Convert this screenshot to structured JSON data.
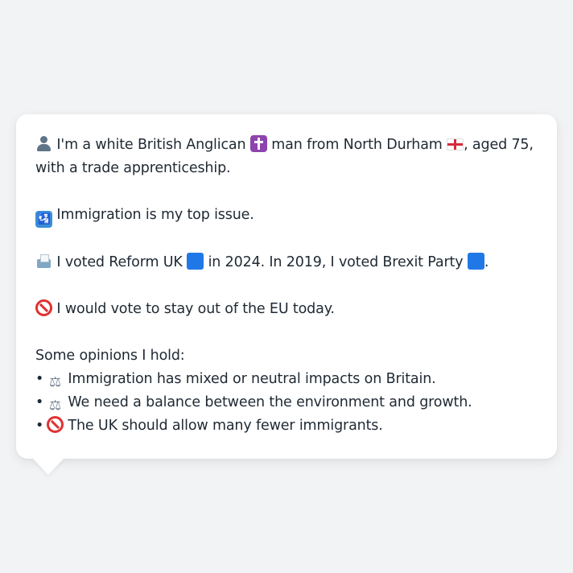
{
  "profile": {
    "intro_text_1": "I'm a white British Anglican",
    "intro_text_2": "man from North Durham",
    "intro_text_3": ", aged 75, with a trade apprenticeship.",
    "issue_text": "Immigration is my top issue.",
    "vote_text_1": "I voted Reform UK",
    "vote_text_2": "in 2024. In 2019, I voted Brexit Party",
    "vote_text_3": ".",
    "eu_text": "I would vote to stay out of the EU today.",
    "opinions_heading": "Some opinions I hold:",
    "opinions": [
      {
        "bullet": "•",
        "icon": "scales-icon",
        "text": "Immigration has mixed or neutral impacts on Britain."
      },
      {
        "bullet": "•",
        "icon": "scales-icon",
        "text": "We need a balance between the environment and growth."
      },
      {
        "bullet": "•",
        "icon": "prohibited-icon",
        "text": "The UK should allow many fewer immigrants."
      }
    ]
  },
  "icons": {
    "person": "person-icon",
    "religion": "cross-icon",
    "region": "england-flag-icon",
    "issue": "passport-control-icon",
    "vote": "ballot-box-icon",
    "party_2024": "blue-square-icon",
    "party_2019": "blue-square-icon",
    "eu": "prohibited-icon",
    "passport_glyph": "🛂",
    "scales_glyph": "⚖"
  },
  "colors": {
    "background": "#f2f3f5",
    "card": "#ffffff",
    "text": "#1f2933",
    "party_blue": "#1f78e6",
    "prohibited_red": "#e03131"
  }
}
